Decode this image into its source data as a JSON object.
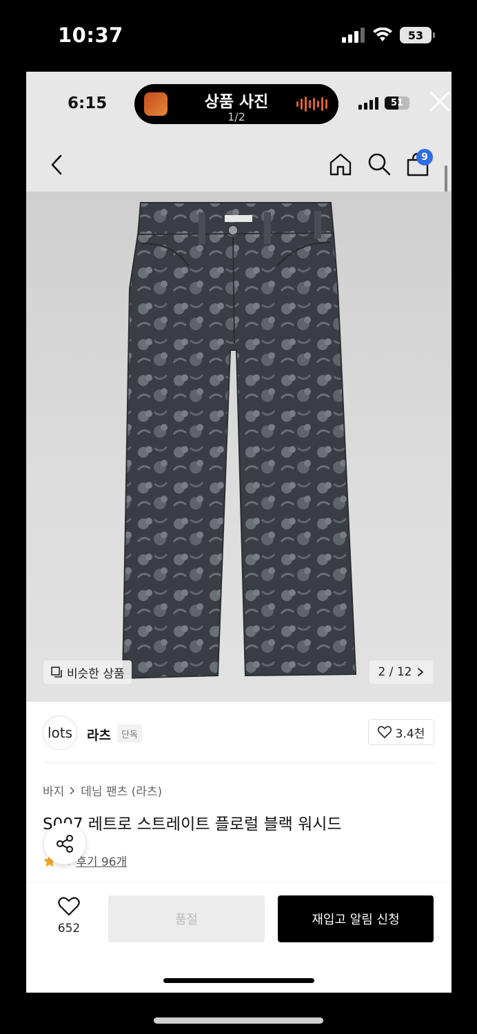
{
  "outer_status": {
    "time": "10:37",
    "battery": "53"
  },
  "inner_status": {
    "time": "6:15",
    "battery": "51"
  },
  "viewer": {
    "title": "상품 사진",
    "counter": "1/2"
  },
  "header": {
    "cart_count": "9"
  },
  "image": {
    "similar_label": "비슷한 상품",
    "counter": "2 / 12"
  },
  "brand": {
    "logo_text": "lots",
    "name": "라츠",
    "tag": "단독",
    "likes": "3.4천"
  },
  "breadcrumb": {
    "category": "바지",
    "subcategory": "데님 팬츠 (라츠)"
  },
  "product": {
    "title": "S007 레트로 스트레이트 플로럴 블랙 워시드",
    "rating": ".8",
    "reviews": "후기 96개"
  },
  "bottom": {
    "wish_count": "652",
    "soldout_label": "품절",
    "restock_label": "재입고 알림 신청"
  },
  "colors": {
    "accent_blue": "#2f6ce5",
    "star": "#f5a623",
    "button_black": "#000000"
  }
}
